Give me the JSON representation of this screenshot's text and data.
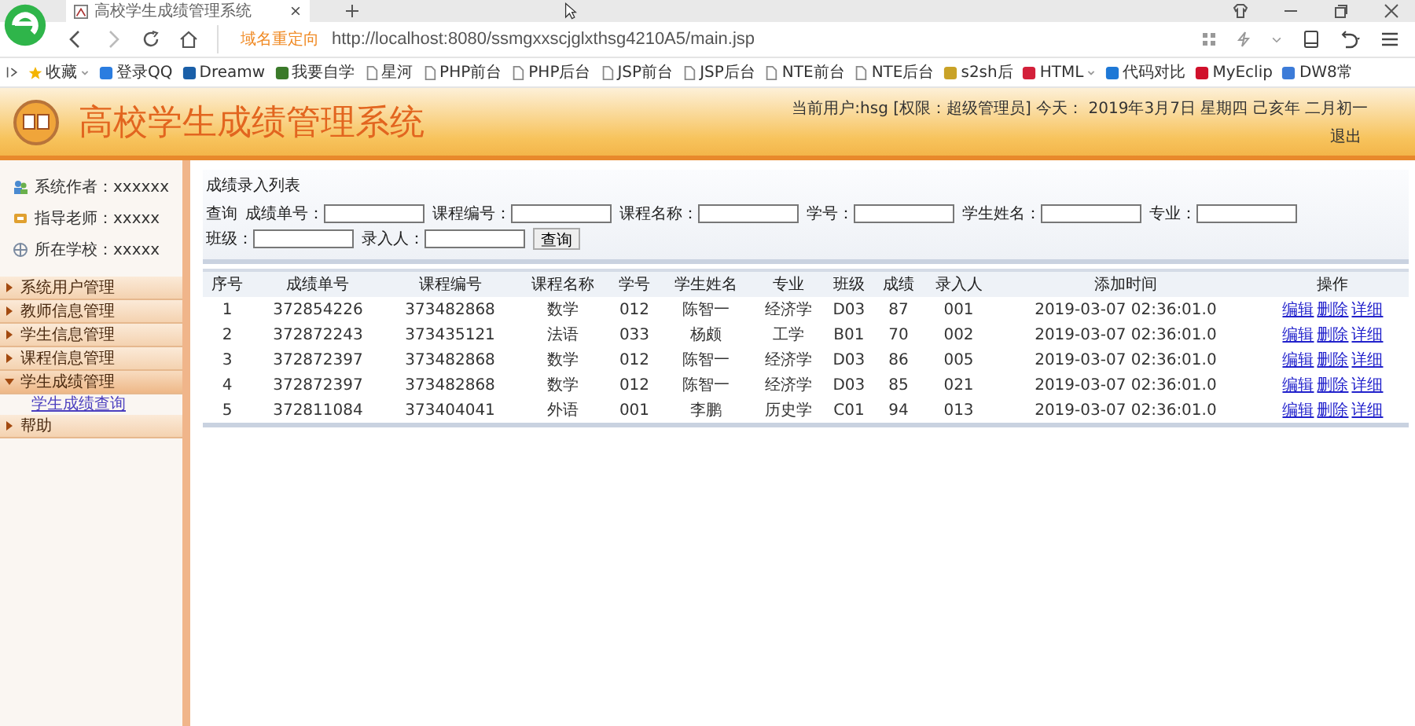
{
  "browser": {
    "tab_title": "高校学生成绩管理系统",
    "address": {
      "redirect_label": "域名重定向",
      "url": "http://localhost:8080/ssmgxxscjglxthsg4210A5/main.jsp"
    },
    "bookmarks": [
      {
        "label": "收藏",
        "kind": "star",
        "has_menu": true
      },
      {
        "label": "登录QQ",
        "kind": "logo",
        "color": "#2b7de0",
        "has_menu": false
      },
      {
        "label": "Dreamw",
        "kind": "logo",
        "color": "#1a5fa8",
        "has_menu": false
      },
      {
        "label": "我要自学",
        "kind": "logo",
        "color": "#3b7a2a",
        "has_menu": false
      },
      {
        "label": "星河",
        "kind": "page",
        "has_menu": false
      },
      {
        "label": "PHP前台",
        "kind": "page",
        "has_menu": false
      },
      {
        "label": "PHP后台",
        "kind": "page",
        "has_menu": false
      },
      {
        "label": "JSP前台",
        "kind": "page",
        "has_menu": false
      },
      {
        "label": "JSP后台",
        "kind": "page",
        "has_menu": false
      },
      {
        "label": "NTE前台",
        "kind": "page",
        "has_menu": false
      },
      {
        "label": "NTE后台",
        "kind": "page",
        "has_menu": false
      },
      {
        "label": "s2sh后",
        "kind": "logo",
        "color": "#c9a227",
        "has_menu": false
      },
      {
        "label": "HTML",
        "kind": "logo",
        "color": "#d3203a",
        "has_menu": true
      },
      {
        "label": "代码对比",
        "kind": "logo",
        "color": "#1e78d6",
        "has_menu": false
      },
      {
        "label": "MyEclip",
        "kind": "logo",
        "color": "#d0102b",
        "has_menu": false
      },
      {
        "label": "DW8常",
        "kind": "logo",
        "color": "#3c7bd8",
        "has_menu": false
      }
    ]
  },
  "header": {
    "title": "高校学生成绩管理系统",
    "user_info": "当前用户:hsg [权限：超级管理员] 今天： 2019年3月7日 星期四 己亥年 二月初一",
    "logout": "退出"
  },
  "sidebar": {
    "info": [
      {
        "kind": "author",
        "text": "系统作者：xxxxxx"
      },
      {
        "kind": "teacher",
        "text": "指导老师：xxxxx"
      },
      {
        "kind": "school",
        "text": "所在学校：xxxxx"
      }
    ],
    "items": [
      {
        "label": "系统用户管理",
        "expanded": false
      },
      {
        "label": "教师信息管理",
        "expanded": false
      },
      {
        "label": "学生信息管理",
        "expanded": false
      },
      {
        "label": "课程信息管理",
        "expanded": false
      },
      {
        "label": "学生成绩管理",
        "expanded": true,
        "children": [
          {
            "label": "学生成绩查询"
          }
        ]
      },
      {
        "label": "帮助",
        "expanded": false
      }
    ]
  },
  "content": {
    "title": "成绩录入列表",
    "search_prefix": "查询",
    "search_fields": [
      {
        "label": "成绩单号："
      },
      {
        "label": "课程编号："
      },
      {
        "label": "课程名称："
      },
      {
        "label": "学号："
      },
      {
        "label": "学生姓名："
      },
      {
        "label": "专业："
      },
      {
        "label": "班级："
      },
      {
        "label": "录入人："
      }
    ],
    "search_button": "查询",
    "table": {
      "columns": [
        "序号",
        "成绩单号",
        "课程编号",
        "课程名称",
        "学号",
        "学生姓名",
        "专业",
        "班级",
        "成绩",
        "录入人",
        "添加时间",
        "操作"
      ],
      "rows": [
        {
          "cells": [
            "1",
            "372854226",
            "373482868",
            "数学",
            "012",
            "陈智一",
            "经济学",
            "D03",
            "87",
            "001",
            "2019-03-07 02:36:01.0"
          ],
          "actions": [
            "编辑",
            "删除",
            "详细"
          ]
        },
        {
          "cells": [
            "2",
            "372872243",
            "373435121",
            "法语",
            "033",
            "杨颇",
            "工学",
            "B01",
            "70",
            "002",
            "2019-03-07 02:36:01.0"
          ],
          "actions": [
            "编辑",
            "删除",
            "详细"
          ]
        },
        {
          "cells": [
            "3",
            "372872397",
            "373482868",
            "数学",
            "012",
            "陈智一",
            "经济学",
            "D03",
            "86",
            "005",
            "2019-03-07 02:36:01.0"
          ],
          "actions": [
            "编辑",
            "删除",
            "详细"
          ]
        },
        {
          "cells": [
            "4",
            "372872397",
            "373482868",
            "数学",
            "012",
            "陈智一",
            "经济学",
            "D03",
            "85",
            "021",
            "2019-03-07 02:36:01.0"
          ],
          "actions": [
            "编辑",
            "删除",
            "详细"
          ]
        },
        {
          "cells": [
            "5",
            "372811084",
            "373404041",
            "外语",
            "001",
            "李鹏",
            "历史学",
            "C01",
            "94",
            "013",
            "2019-03-07 02:36:01.0"
          ],
          "actions": [
            "编辑",
            "删除",
            "详细"
          ]
        }
      ]
    }
  }
}
